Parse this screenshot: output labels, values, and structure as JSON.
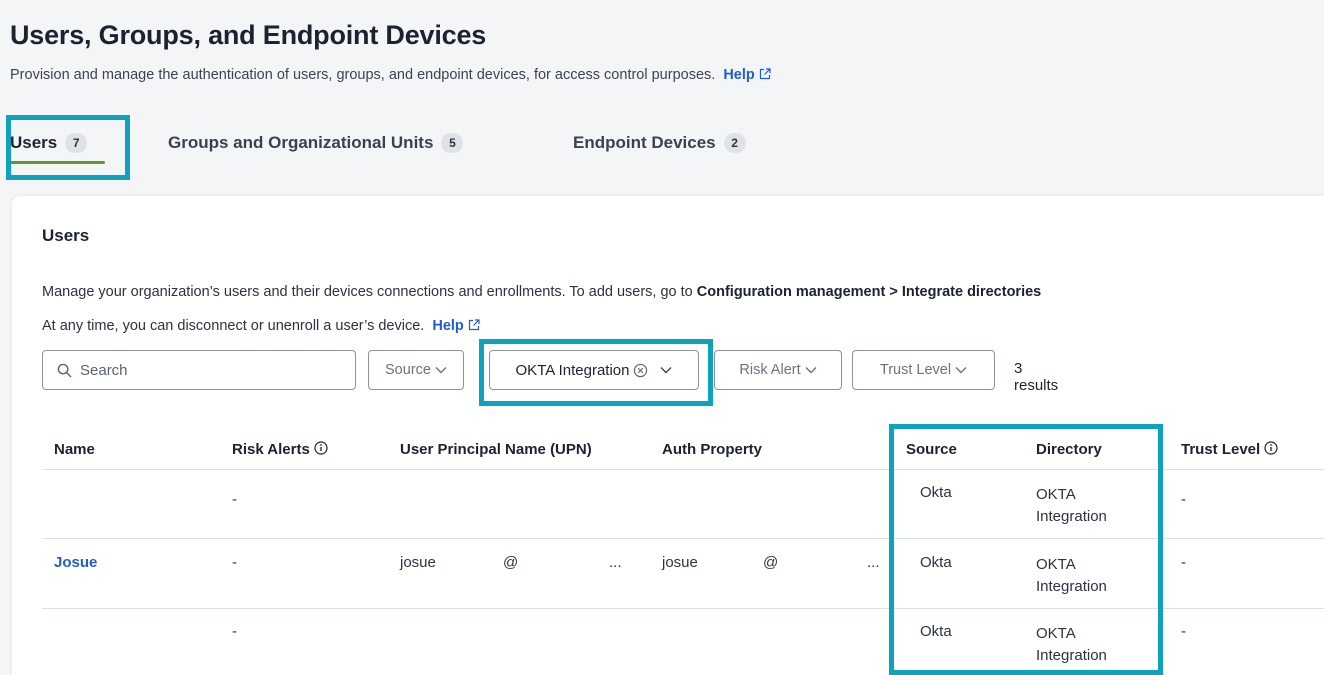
{
  "header": {
    "title": "Users, Groups, and Endpoint Devices",
    "description": "Provision and manage the authentication of users, groups, and endpoint devices, for access control purposes.",
    "help_label": "Help"
  },
  "tabs": [
    {
      "label": "Users",
      "count": "7",
      "active": true
    },
    {
      "label": "Groups and Organizational Units",
      "count": "5",
      "active": false
    },
    {
      "label": "Endpoint Devices",
      "count": "2",
      "active": false
    }
  ],
  "users_panel": {
    "title": "Users",
    "description_prefix": "Manage your organization’s users and their devices connections and enrollments. To add users, go to",
    "description_link": "Configuration management > Integrate directories",
    "description_line2": "At any time, you can disconnect or unenroll a user’s device.",
    "help_label": "Help"
  },
  "filters": {
    "search_placeholder": "Search",
    "source_label": "Source",
    "directory_selected": "OKTA Integration",
    "risk_alert_label": "Risk Alert",
    "trust_level_label": "Trust Level",
    "results_text": "3 results"
  },
  "table": {
    "columns": [
      "Name",
      "Risk Alerts",
      "User Principal Name (UPN)",
      "Auth Property",
      "Source",
      "Directory",
      "Trust Level"
    ],
    "rows": [
      {
        "name": "",
        "risk_alerts": "-",
        "upn_user": "",
        "upn_at": "",
        "upn_more": "",
        "auth_user": "",
        "auth_at": "",
        "auth_more": "",
        "source": "Okta",
        "directory": "OKTA Integration",
        "trust_level": "-"
      },
      {
        "name": "Josue",
        "risk_alerts": "-",
        "upn_user": "josue",
        "upn_at": "@",
        "upn_more": "...",
        "auth_user": "josue",
        "auth_at": "@",
        "auth_more": "...",
        "source": "Okta",
        "directory": "OKTA Integration",
        "trust_level": "-"
      },
      {
        "name": "",
        "risk_alerts": "-",
        "upn_user": "",
        "upn_at": "",
        "upn_more": "",
        "auth_user": "",
        "auth_at": "",
        "auth_more": "",
        "source": "Okta",
        "directory": "OKTA Integration",
        "trust_level": "-"
      }
    ]
  },
  "colors": {
    "highlight": "#0fa2bd",
    "link": "#1d5fd1",
    "tab_underline": "#5c9b2b"
  },
  "icons": {
    "external_link": "external-link-icon",
    "search": "search-icon",
    "chevron": "chevron-down-icon",
    "clear": "clear-circle-icon",
    "info": "info-icon"
  }
}
